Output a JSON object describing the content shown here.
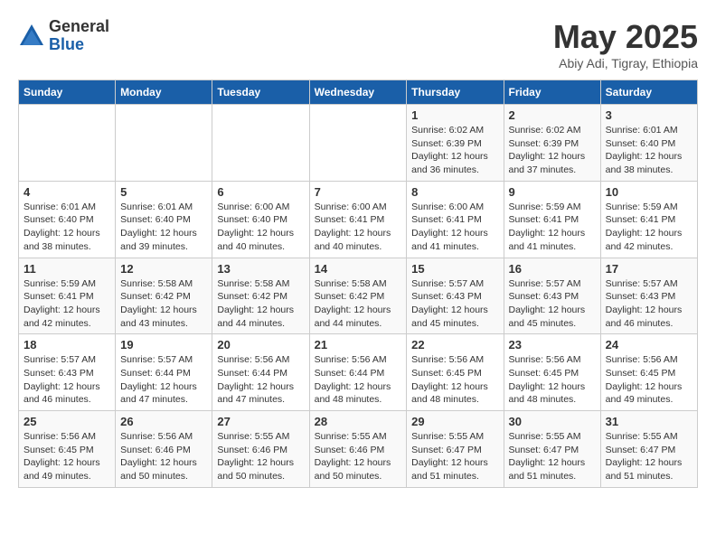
{
  "logo": {
    "general": "General",
    "blue": "Blue"
  },
  "title": "May 2025",
  "location": "Abiy Adi, Tigray, Ethiopia",
  "days_of_week": [
    "Sunday",
    "Monday",
    "Tuesday",
    "Wednesday",
    "Thursday",
    "Friday",
    "Saturday"
  ],
  "weeks": [
    [
      {
        "day": "",
        "info": ""
      },
      {
        "day": "",
        "info": ""
      },
      {
        "day": "",
        "info": ""
      },
      {
        "day": "",
        "info": ""
      },
      {
        "day": "1",
        "info": "Sunrise: 6:02 AM\nSunset: 6:39 PM\nDaylight: 12 hours\nand 36 minutes."
      },
      {
        "day": "2",
        "info": "Sunrise: 6:02 AM\nSunset: 6:39 PM\nDaylight: 12 hours\nand 37 minutes."
      },
      {
        "day": "3",
        "info": "Sunrise: 6:01 AM\nSunset: 6:40 PM\nDaylight: 12 hours\nand 38 minutes."
      }
    ],
    [
      {
        "day": "4",
        "info": "Sunrise: 6:01 AM\nSunset: 6:40 PM\nDaylight: 12 hours\nand 38 minutes."
      },
      {
        "day": "5",
        "info": "Sunrise: 6:01 AM\nSunset: 6:40 PM\nDaylight: 12 hours\nand 39 minutes."
      },
      {
        "day": "6",
        "info": "Sunrise: 6:00 AM\nSunset: 6:40 PM\nDaylight: 12 hours\nand 40 minutes."
      },
      {
        "day": "7",
        "info": "Sunrise: 6:00 AM\nSunset: 6:41 PM\nDaylight: 12 hours\nand 40 minutes."
      },
      {
        "day": "8",
        "info": "Sunrise: 6:00 AM\nSunset: 6:41 PM\nDaylight: 12 hours\nand 41 minutes."
      },
      {
        "day": "9",
        "info": "Sunrise: 5:59 AM\nSunset: 6:41 PM\nDaylight: 12 hours\nand 41 minutes."
      },
      {
        "day": "10",
        "info": "Sunrise: 5:59 AM\nSunset: 6:41 PM\nDaylight: 12 hours\nand 42 minutes."
      }
    ],
    [
      {
        "day": "11",
        "info": "Sunrise: 5:59 AM\nSunset: 6:41 PM\nDaylight: 12 hours\nand 42 minutes."
      },
      {
        "day": "12",
        "info": "Sunrise: 5:58 AM\nSunset: 6:42 PM\nDaylight: 12 hours\nand 43 minutes."
      },
      {
        "day": "13",
        "info": "Sunrise: 5:58 AM\nSunset: 6:42 PM\nDaylight: 12 hours\nand 44 minutes."
      },
      {
        "day": "14",
        "info": "Sunrise: 5:58 AM\nSunset: 6:42 PM\nDaylight: 12 hours\nand 44 minutes."
      },
      {
        "day": "15",
        "info": "Sunrise: 5:57 AM\nSunset: 6:43 PM\nDaylight: 12 hours\nand 45 minutes."
      },
      {
        "day": "16",
        "info": "Sunrise: 5:57 AM\nSunset: 6:43 PM\nDaylight: 12 hours\nand 45 minutes."
      },
      {
        "day": "17",
        "info": "Sunrise: 5:57 AM\nSunset: 6:43 PM\nDaylight: 12 hours\nand 46 minutes."
      }
    ],
    [
      {
        "day": "18",
        "info": "Sunrise: 5:57 AM\nSunset: 6:43 PM\nDaylight: 12 hours\nand 46 minutes."
      },
      {
        "day": "19",
        "info": "Sunrise: 5:57 AM\nSunset: 6:44 PM\nDaylight: 12 hours\nand 47 minutes."
      },
      {
        "day": "20",
        "info": "Sunrise: 5:56 AM\nSunset: 6:44 PM\nDaylight: 12 hours\nand 47 minutes."
      },
      {
        "day": "21",
        "info": "Sunrise: 5:56 AM\nSunset: 6:44 PM\nDaylight: 12 hours\nand 48 minutes."
      },
      {
        "day": "22",
        "info": "Sunrise: 5:56 AM\nSunset: 6:45 PM\nDaylight: 12 hours\nand 48 minutes."
      },
      {
        "day": "23",
        "info": "Sunrise: 5:56 AM\nSunset: 6:45 PM\nDaylight: 12 hours\nand 48 minutes."
      },
      {
        "day": "24",
        "info": "Sunrise: 5:56 AM\nSunset: 6:45 PM\nDaylight: 12 hours\nand 49 minutes."
      }
    ],
    [
      {
        "day": "25",
        "info": "Sunrise: 5:56 AM\nSunset: 6:45 PM\nDaylight: 12 hours\nand 49 minutes."
      },
      {
        "day": "26",
        "info": "Sunrise: 5:56 AM\nSunset: 6:46 PM\nDaylight: 12 hours\nand 50 minutes."
      },
      {
        "day": "27",
        "info": "Sunrise: 5:55 AM\nSunset: 6:46 PM\nDaylight: 12 hours\nand 50 minutes."
      },
      {
        "day": "28",
        "info": "Sunrise: 5:55 AM\nSunset: 6:46 PM\nDaylight: 12 hours\nand 50 minutes."
      },
      {
        "day": "29",
        "info": "Sunrise: 5:55 AM\nSunset: 6:47 PM\nDaylight: 12 hours\nand 51 minutes."
      },
      {
        "day": "30",
        "info": "Sunrise: 5:55 AM\nSunset: 6:47 PM\nDaylight: 12 hours\nand 51 minutes."
      },
      {
        "day": "31",
        "info": "Sunrise: 5:55 AM\nSunset: 6:47 PM\nDaylight: 12 hours\nand 51 minutes."
      }
    ]
  ]
}
